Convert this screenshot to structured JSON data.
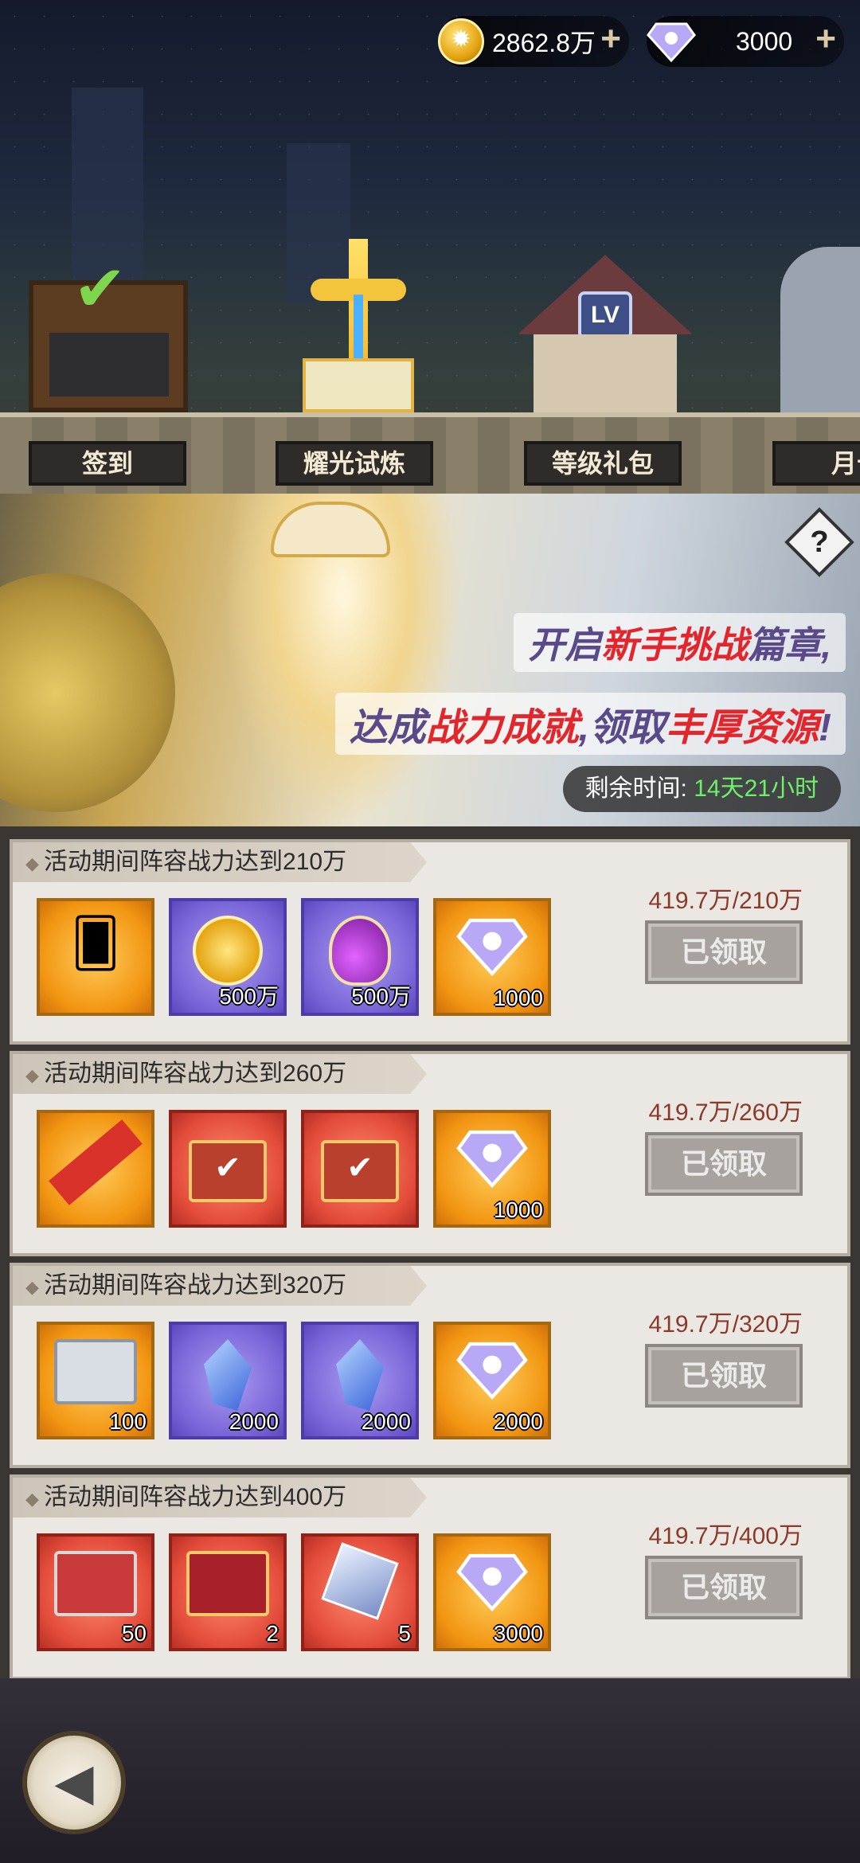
{
  "currency": {
    "gold": "2862.8万",
    "diamond": "3000",
    "add_symbol": "+"
  },
  "tabs": [
    {
      "label": "签到"
    },
    {
      "label": "耀光试炼"
    },
    {
      "label": "等级礼包"
    },
    {
      "label": "月十"
    }
  ],
  "banner": {
    "help": "?",
    "line1_a": "开启",
    "line1_b": "新手",
    "line1_c": "挑战",
    "line1_d": "篇章,",
    "line2_a": "达成",
    "line2_b": "战力成就",
    "line2_c": ",领取",
    "line2_d": "丰厚资源",
    "line2_e": "!",
    "timer_label": "剩余时间:",
    "timer_value": "14天21小时"
  },
  "quests": [
    {
      "title": "活动期间阵容战力达到210万",
      "progress": "419.7万/210万",
      "button": "已领取",
      "rewards": [
        {
          "icon": "hero-card-icon",
          "qty": ""
        },
        {
          "icon": "gold-coin-icon",
          "qty": "500万"
        },
        {
          "icon": "potion-icon",
          "qty": "500万"
        },
        {
          "icon": "diamond-icon",
          "qty": "1000"
        }
      ]
    },
    {
      "title": "活动期间阵容战力达到260万",
      "progress": "419.7万/260万",
      "button": "已领取",
      "rewards": [
        {
          "icon": "hero-ticket-icon",
          "qty": ""
        },
        {
          "icon": "equipment-chest-icon",
          "qty": ""
        },
        {
          "icon": "equipment-chest-icon",
          "qty": ""
        },
        {
          "icon": "diamond-icon",
          "qty": "1000"
        }
      ]
    },
    {
      "title": "活动期间阵容战力达到320万",
      "progress": "419.7万/320万",
      "button": "已领取",
      "rewards": [
        {
          "icon": "silver-chest-icon",
          "qty": "100"
        },
        {
          "icon": "blue-crystal-icon",
          "qty": "2000"
        },
        {
          "icon": "blue-crystal-icon",
          "qty": "2000"
        },
        {
          "icon": "diamond-icon",
          "qty": "2000"
        }
      ]
    },
    {
      "title": "活动期间阵容战力达到400万",
      "progress": "419.7万/400万",
      "button": "已领取",
      "rewards": [
        {
          "icon": "red-chest-icon",
          "qty": "50"
        },
        {
          "icon": "treasure-chest-icon",
          "qty": "2"
        },
        {
          "icon": "crystal-cube-icon",
          "qty": "5"
        },
        {
          "icon": "diamond-icon",
          "qty": "3000"
        }
      ]
    }
  ],
  "back_button": "◀"
}
